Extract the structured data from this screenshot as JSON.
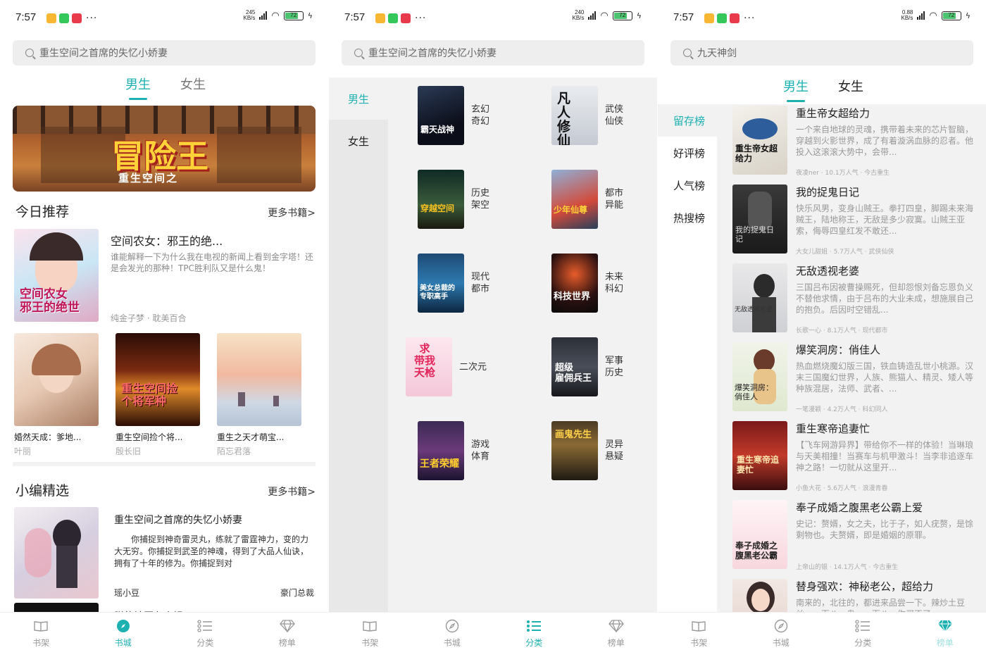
{
  "status": {
    "time": "7:57",
    "s1_speed": "245\nKB/s",
    "s2_speed": "240\nKB/s",
    "s3_speed": "0.88\nKB/s",
    "battery": "72"
  },
  "colors": {
    "accent": "#1cb0b0",
    "app1": "#f7b733",
    "app2": "#34c759",
    "app3": "#e83a4a"
  },
  "screen1": {
    "search_placeholder": "重生空间之首席的失忆小娇妻",
    "tabs": [
      "男生",
      "女生"
    ],
    "banner_title": "冒险王",
    "banner_sub": "重生空间之",
    "today": {
      "title": "今日推荐",
      "more": "更多书籍>"
    },
    "featured": {
      "title": "空间农女：邪王的绝...",
      "desc": "谁能解释一下为什么我在电视的新闻上看到金字塔！还是会发光的那种！TPC胜利队又是什么鬼！",
      "meta": "纯金子梦 · 耽美百合",
      "cover_text": "空间农女\n邪王的绝世"
    },
    "grid": [
      {
        "title": "婚然天成：爹地...",
        "author": "叶丽"
      },
      {
        "title": "重生空间捡个将...",
        "author": "殷长旧",
        "cover_text": "重生空间捡\n个将军种"
      },
      {
        "title": "重生之天才萌宝...",
        "author": "陌忘君落"
      }
    ],
    "editor": {
      "title": "小编精选",
      "more": "更多书籍>"
    },
    "pick": {
      "title": "重生空间之首席的失忆小娇妻",
      "desc": "你捕捉到神奇雷灵丸，练就了雷霆神力，变的力大无穷。你捕捉到武圣的神魂，得到了大品人仙诀，拥有了十年的修为。你捕捉到对",
      "author": "瑶小豆",
      "tag": "豪门总裁"
    },
    "next_title": "朕的神医九小姐"
  },
  "nav": [
    "书架",
    "书城",
    "分类",
    "榜单"
  ],
  "screen2": {
    "search_placeholder": "重生空间之首席的失忆小娇妻",
    "side": [
      "男生",
      "女生"
    ],
    "cats": [
      {
        "label": "玄幻\n奇幻",
        "cover_text": "霸天战神"
      },
      {
        "label": "武侠\n仙侠",
        "cover_text": "凡人修仙"
      },
      {
        "label": "历史\n架空",
        "cover_text": "穿越空间"
      },
      {
        "label": "都市\n异能",
        "cover_text": "少年仙尊"
      },
      {
        "label": "现代\n都市",
        "cover_text": "美女总裁的\n专职高手"
      },
      {
        "label": "未来\n科幻",
        "cover_text": "科技世界"
      },
      {
        "label": "二次元",
        "cover_text": "求\n带我\n天枪"
      },
      {
        "label": "军事\n历史",
        "cover_text": "超级\n雇佣兵王"
      },
      {
        "label": "游戏\n体育",
        "cover_text": "王者荣耀"
      },
      {
        "label": "灵异\n悬疑",
        "cover_text": "画鬼先生"
      }
    ]
  },
  "screen3": {
    "search_placeholder": "九天神剑",
    "tabs": [
      "男生",
      "女生"
    ],
    "side": [
      "留存榜",
      "好评榜",
      "人气榜",
      "热搜榜"
    ],
    "items": [
      {
        "title": "重生帝女超给力",
        "desc": "一个来自地球的灵魂，携带着未来的芯片智脑，穿越到火影世界，成了有着漩涡血脉的忍者。他投入这滚滚大势中，会带...",
        "meta": "夜凌ner · 10.1万人气 · 今古重生",
        "cover_text": "重生帝女超\n给力"
      },
      {
        "title": "我的捉鬼日记",
        "desc": "快乐风男，变身山贼王。拳打四皇，脚踢未来海贼王，陆地称王，无敌是多少寂寞。山贼王亚索，侮辱四皇红发不敢还...",
        "meta": "大女儿甜姐 · 5.7万人气 · 武侠仙侠",
        "cover_text": "我的捉鬼日\n记"
      },
      {
        "title": "无敌透视老婆",
        "desc": "三国吕布因被曹操赐死，但却怨恨刘备忘恩负义不替他求情，由于吕布的大业未成，想施展自己的抱负。后因时空错乱...",
        "meta": "长歌一心 · 8.1万人气 · 现代都市",
        "cover_text": "无敌透视老婆"
      },
      {
        "title": "爆笑洞房：俏佳人",
        "desc": "热血燃烧魔幻版三国，铁血铸造乱世小桃源。汉末三国魔幻世界，人族、熊猫人、精灵、矮人等种族混居，法师、武者、...",
        "meta": "一笔漫颖 · 4.2万人气 · 科幻同人",
        "cover_text": "爆笑洞房：\n俏佳人"
      },
      {
        "title": "重生寒帝追妻忙",
        "desc": "【飞车网游异界】带给你不一样的体验！当琳琅与天美相撞！当赛车与机甲激斗！当李非追逐车神之路！一切就从这里开...",
        "meta": "小鱼大花 · 5.6万人气 · 浪漫青春",
        "cover_text": "重生寒帝追\n妻忙"
      },
      {
        "title": "奉子成婚之腹黑老公霸上爱",
        "desc": "史记：赘婿，女之夫，比于子，如人疣赘，是馀剩物也。夫赘婿，即是婚姻的原罪。",
        "meta": "上帝山的银 · 14.1万人气 · 今古重生",
        "cover_text": "奉子成婚之\n腹黑老公霸"
      },
      {
        "title": "替身强欢：神秘老公，超给力",
        "desc": "南来的，北往的，都进来品尝一下。辣炒土豆丝，一百八一盘。一百八，你买不了",
        "meta": "",
        "cover_text": ""
      }
    ]
  }
}
